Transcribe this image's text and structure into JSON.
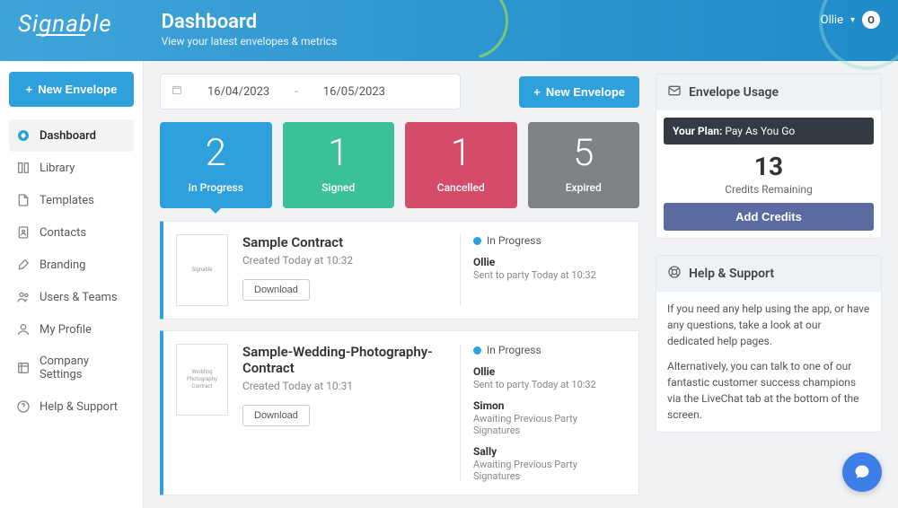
{
  "header": {
    "logo": "Signable",
    "title": "Dashboard",
    "subtitle": "View your latest envelopes & metrics",
    "user_name": "Ollie",
    "badge": "O"
  },
  "sidebar": {
    "new_envelope": "New Envelope",
    "items": [
      {
        "label": "Dashboard",
        "icon": "home"
      },
      {
        "label": "Library",
        "icon": "library"
      },
      {
        "label": "Templates",
        "icon": "file"
      },
      {
        "label": "Contacts",
        "icon": "contacts"
      },
      {
        "label": "Branding",
        "icon": "brush"
      },
      {
        "label": "Users & Teams",
        "icon": "users"
      },
      {
        "label": "My Profile",
        "icon": "profile"
      },
      {
        "label": "Company Settings",
        "icon": "settings"
      },
      {
        "label": "Help & Support",
        "icon": "help"
      }
    ]
  },
  "topbar": {
    "date_from": "16/04/2023",
    "date_sep": "-",
    "date_to": "16/05/2023",
    "new_envelope": "New Envelope"
  },
  "metrics": [
    {
      "value": "2",
      "label": "In Progress",
      "color": "blue"
    },
    {
      "value": "1",
      "label": "Signed",
      "color": "green"
    },
    {
      "value": "1",
      "label": "Cancelled",
      "color": "red"
    },
    {
      "value": "5",
      "label": "Expired",
      "color": "gray"
    }
  ],
  "envelopes": [
    {
      "title": "Sample Contract",
      "created": "Created Today at 10:32",
      "download": "Download",
      "status": "In Progress",
      "thumb_text": "Signable",
      "parties": [
        {
          "name": "Ollie",
          "status": "Sent to party Today at 10:32"
        }
      ]
    },
    {
      "title": "Sample-Wedding-Photography-Contract",
      "created": "Created Today at 10:31",
      "download": "Download",
      "status": "In Progress",
      "thumb_text": "Wedding Photography Contract",
      "parties": [
        {
          "name": "Ollie",
          "status": "Sent to party Today at 10:32"
        },
        {
          "name": "Simon",
          "status": "Awaiting Previous Party Signatures"
        },
        {
          "name": "Sally",
          "status": "Awaiting Previous Party Signatures"
        }
      ]
    }
  ],
  "usage": {
    "title": "Envelope Usage",
    "plan_label": "Your Plan:",
    "plan_name": "Pay As You Go",
    "credits_value": "13",
    "credits_label": "Credits Remaining",
    "add_credits": "Add Credits"
  },
  "help": {
    "title": "Help & Support",
    "p1": "If you need any help using the app, or have any questions, take a look at our dedicated help pages.",
    "p2": "Alternatively, you can talk to one of our fantastic customer success champions via the LiveChat tab at the bottom of the screen."
  }
}
